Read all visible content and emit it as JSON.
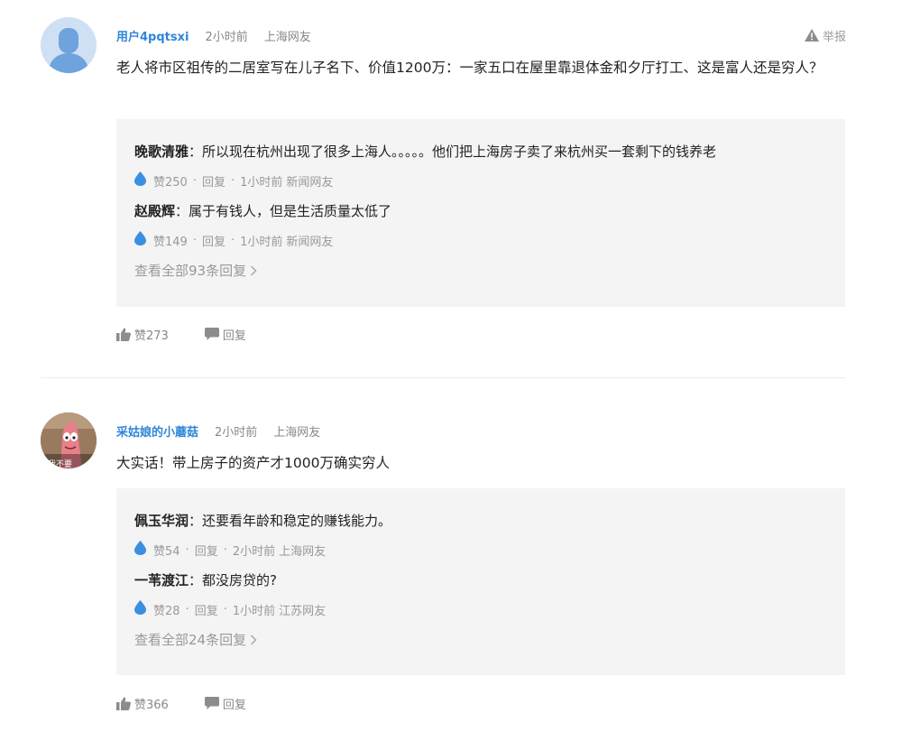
{
  "comments": [
    {
      "username": "用户4pqtsxi",
      "time": "2小时前",
      "location": "上海网友",
      "report_label": "举报",
      "content": "老人将市区祖传的二居室写在儿子名下、价值1200万：一家五口在屋里靠退体金和夕厅打工、这是富人还是穷人？",
      "replies": [
        {
          "user": "晚歌清雅",
          "text": "：所以现在杭州出现了很多上海人。。。。。他们把上海房子卖了来杭州买一套剩下的钱养老",
          "likes": "赞250",
          "reply_label": "回复",
          "time": "1小时前",
          "location": "新闻网友"
        },
        {
          "user": "赵殿辉",
          "text": "：属于有钱人，但是生活质量太低了",
          "likes": "赞149",
          "reply_label": "回复",
          "time": "1小时前",
          "location": "新闻网友"
        }
      ],
      "view_all": "查看全部93条回复",
      "like_label": "赞273",
      "reply_label": "回复"
    },
    {
      "username": "采姑娘的小蘑菇",
      "time": "2小时前",
      "location": "上海网友",
      "avatar_text": "我不要",
      "content": "大实话！带上房子的资产才1000万确实穷人",
      "replies": [
        {
          "user": "佩玉华润",
          "text": "：还要看年龄和稳定的赚钱能力。",
          "likes": "赞54",
          "reply_label": "回复",
          "time": "2小时前",
          "location": "上海网友"
        },
        {
          "user": "一苇渡江",
          "text": "：都没房贷的?",
          "likes": "赞28",
          "reply_label": "回复",
          "time": "1小时前",
          "location": "江苏网友"
        }
      ],
      "view_all": "查看全部24条回复",
      "like_label": "赞366",
      "reply_label": "回复"
    }
  ],
  "colors": {
    "username": "#2f86d9",
    "meta": "#888888",
    "reply_bg": "#f4f4f4",
    "like_icon": "#3b8fe0"
  }
}
